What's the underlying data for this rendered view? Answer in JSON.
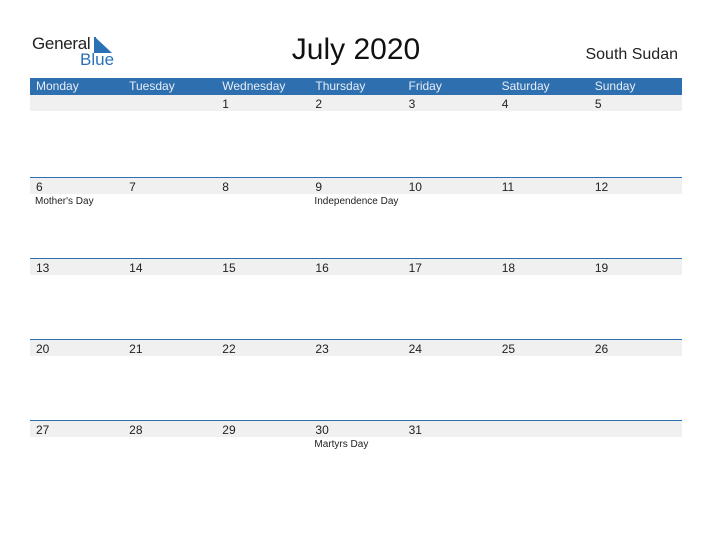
{
  "logo": {
    "line1": "General",
    "line2": "Blue",
    "icon": "triangle-flag-icon",
    "accent": "#2a72b5"
  },
  "title": "July 2020",
  "country": "South Sudan",
  "colors": {
    "header_bg": "#2e6fb0",
    "date_strip": "#f0f0f0"
  },
  "weekdays": [
    "Monday",
    "Tuesday",
    "Wednesday",
    "Thursday",
    "Friday",
    "Saturday",
    "Sunday"
  ],
  "weeks": [
    [
      {
        "day": ""
      },
      {
        "day": ""
      },
      {
        "day": "1"
      },
      {
        "day": "2"
      },
      {
        "day": "3"
      },
      {
        "day": "4"
      },
      {
        "day": "5"
      }
    ],
    [
      {
        "day": "6",
        "holiday": "Mother's Day"
      },
      {
        "day": "7"
      },
      {
        "day": "8"
      },
      {
        "day": "9",
        "holiday": "Independence Day"
      },
      {
        "day": "10"
      },
      {
        "day": "11"
      },
      {
        "day": "12"
      }
    ],
    [
      {
        "day": "13"
      },
      {
        "day": "14"
      },
      {
        "day": "15"
      },
      {
        "day": "16"
      },
      {
        "day": "17"
      },
      {
        "day": "18"
      },
      {
        "day": "19"
      }
    ],
    [
      {
        "day": "20"
      },
      {
        "day": "21"
      },
      {
        "day": "22"
      },
      {
        "day": "23"
      },
      {
        "day": "24"
      },
      {
        "day": "25"
      },
      {
        "day": "26"
      }
    ],
    [
      {
        "day": "27"
      },
      {
        "day": "28"
      },
      {
        "day": "29"
      },
      {
        "day": "30",
        "holiday": "Martyrs Day"
      },
      {
        "day": "31"
      },
      {
        "day": ""
      },
      {
        "day": ""
      }
    ]
  ]
}
